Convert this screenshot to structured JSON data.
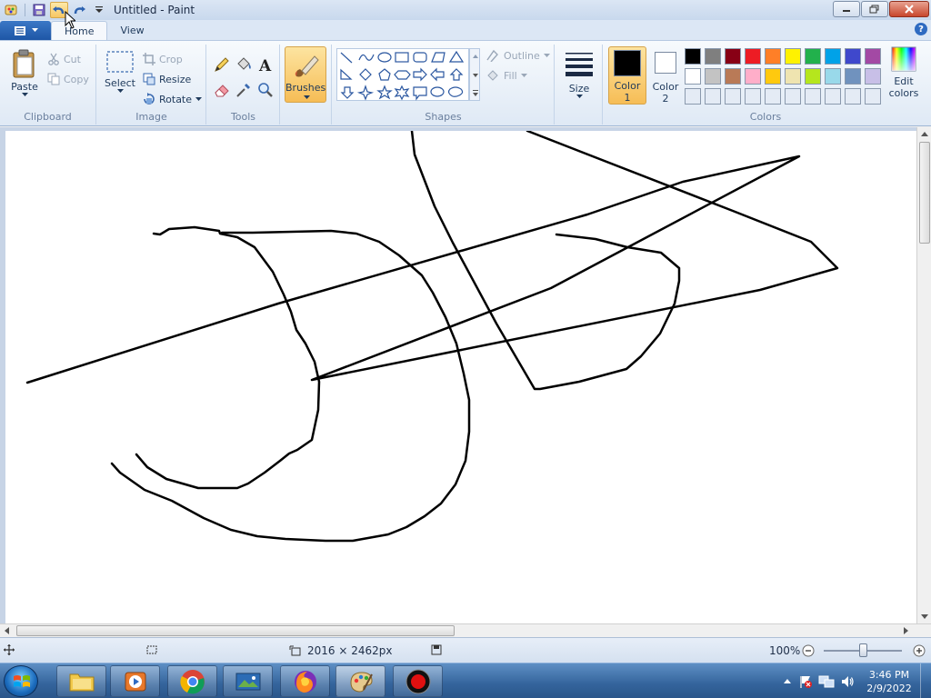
{
  "window": {
    "title": "Untitled - Paint"
  },
  "tabs": {
    "file_tab": "",
    "home": "Home",
    "view": "View"
  },
  "clipboard": {
    "paste": "Paste",
    "cut": "Cut",
    "copy": "Copy",
    "label": "Clipboard"
  },
  "image": {
    "select": "Select",
    "crop": "Crop",
    "resize": "Resize",
    "rotate": "Rotate",
    "label": "Image"
  },
  "tools": {
    "label": "Tools"
  },
  "brushes": {
    "label": "Brushes"
  },
  "shapes": {
    "outline": "Outline",
    "fill": "Fill",
    "label": "Shapes"
  },
  "size": {
    "label": "Size"
  },
  "colors": {
    "color1_line1": "Color",
    "color1_line2": "1",
    "color2_line1": "Color",
    "color2_line2": "2",
    "edit_line1": "Edit",
    "edit_line2": "colors",
    "label": "Colors",
    "color1_value": "#000000",
    "color2_value": "#ffffff",
    "palette_row1": [
      "#000000",
      "#7f7f7f",
      "#880015",
      "#ed1c24",
      "#ff7f27",
      "#fff200",
      "#22b14c",
      "#00a2e8",
      "#3f48cc",
      "#a349a4"
    ],
    "palette_row2": [
      "#ffffff",
      "#c3c3c3",
      "#b97a57",
      "#ffaec9",
      "#ffc90e",
      "#efe4b0",
      "#b5e61d",
      "#99d9ea",
      "#7092be",
      "#c8bfe7"
    ]
  },
  "status": {
    "dimensions": "2016 × 2462px",
    "zoom": "100%"
  },
  "taskbar": {
    "time": "3:46 PM",
    "date": "2/9/2022"
  }
}
